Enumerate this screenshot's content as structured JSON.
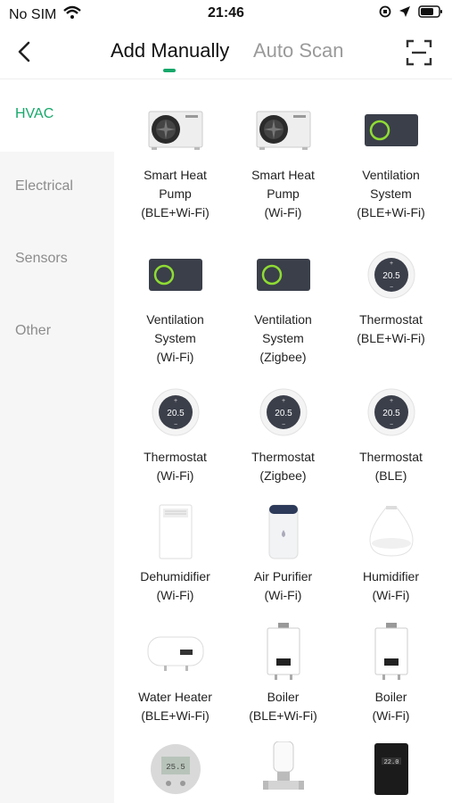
{
  "status": {
    "carrier": "No SIM",
    "time": "21:46"
  },
  "header": {
    "tab_active": "Add Manually",
    "tab_inactive": "Auto Scan",
    "accent": "#17a86b"
  },
  "sidebar": {
    "items": [
      {
        "label": "HVAC",
        "active": true
      },
      {
        "label": "Electrical",
        "active": false
      },
      {
        "label": "Sensors",
        "active": false
      },
      {
        "label": "Other",
        "active": false
      }
    ]
  },
  "devices": [
    {
      "name_lines": [
        "Smart Heat",
        "Pump"
      ],
      "conn": "(BLE+Wi-Fi)",
      "icon": "heat-pump-icon"
    },
    {
      "name_lines": [
        "Smart Heat",
        "Pump"
      ],
      "conn": "(Wi-Fi)",
      "icon": "heat-pump-icon"
    },
    {
      "name_lines": [
        "Ventilation",
        "System"
      ],
      "conn": "(BLE+Wi-Fi)",
      "icon": "ventilation-icon"
    },
    {
      "name_lines": [
        "Ventilation",
        "System"
      ],
      "conn": "(Wi-Fi)",
      "icon": "ventilation-icon"
    },
    {
      "name_lines": [
        "Ventilation",
        "System"
      ],
      "conn": "(Zigbee)",
      "icon": "ventilation-icon"
    },
    {
      "name_lines": [
        "Thermostat"
      ],
      "conn": "(BLE+Wi-Fi)",
      "icon": "thermostat-icon",
      "readout": "20.5"
    },
    {
      "name_lines": [
        "Thermostat"
      ],
      "conn": "(Wi-Fi)",
      "icon": "thermostat-icon",
      "readout": "20.5"
    },
    {
      "name_lines": [
        "Thermostat"
      ],
      "conn": "(Zigbee)",
      "icon": "thermostat-icon",
      "readout": "20.5"
    },
    {
      "name_lines": [
        "Thermostat"
      ],
      "conn": "(BLE)",
      "icon": "thermostat-icon",
      "readout": "20.5"
    },
    {
      "name_lines": [
        "Dehumidifier"
      ],
      "conn": "(Wi-Fi)",
      "icon": "dehumidifier-icon"
    },
    {
      "name_lines": [
        "Air Purifier"
      ],
      "conn": "(Wi-Fi)",
      "icon": "air-purifier-icon"
    },
    {
      "name_lines": [
        "Humidifier"
      ],
      "conn": "(Wi-Fi)",
      "icon": "humidifier-icon"
    },
    {
      "name_lines": [
        "Water Heater"
      ],
      "conn": "(BLE+Wi-Fi)",
      "icon": "water-heater-icon"
    },
    {
      "name_lines": [
        "Boiler"
      ],
      "conn": "(BLE+Wi-Fi)",
      "icon": "boiler-icon"
    },
    {
      "name_lines": [
        "Boiler"
      ],
      "conn": "(Wi-Fi)",
      "icon": "boiler-icon"
    },
    {
      "name_lines": [],
      "conn": "",
      "icon": "thermostat-panel-icon"
    },
    {
      "name_lines": [],
      "conn": "",
      "icon": "radiator-valve-icon"
    },
    {
      "name_lines": [],
      "conn": "",
      "icon": "wall-controller-icon"
    }
  ]
}
